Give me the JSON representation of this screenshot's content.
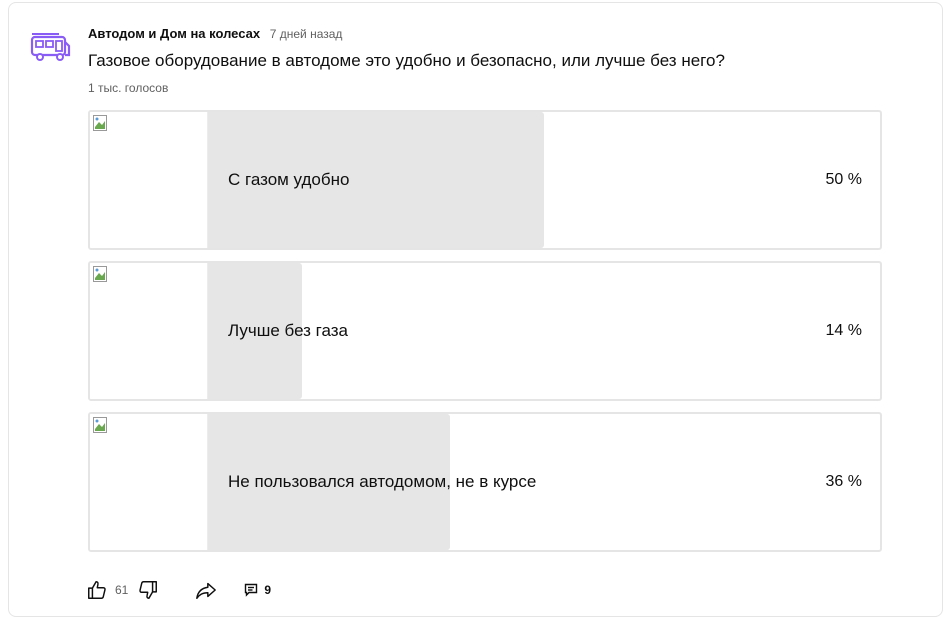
{
  "post": {
    "channel_name": "Автодом и Дом на колесах",
    "time": "7 дней назад",
    "avatar_icon": "camper-van-icon",
    "accent_color": "#8a5cf6"
  },
  "poll": {
    "question": "Газовое оборудование в автодоме это удобно и безопасно, или лучше без него?",
    "votes": "1 тыс. голосов",
    "options": [
      {
        "label": "С газом удобно",
        "percent_text": "50 %",
        "percent": 50
      },
      {
        "label": "Лучше без газа",
        "percent_text": "14 %",
        "percent": 14
      },
      {
        "label": "Не пользовался автодомом, не в курсе",
        "percent_text": "36 %",
        "percent": 36
      }
    ]
  },
  "actions": {
    "likes": "61",
    "comments": "9",
    "icons": [
      "thumb-up-icon",
      "thumb-down-icon",
      "share-icon",
      "comment-icon"
    ]
  }
}
